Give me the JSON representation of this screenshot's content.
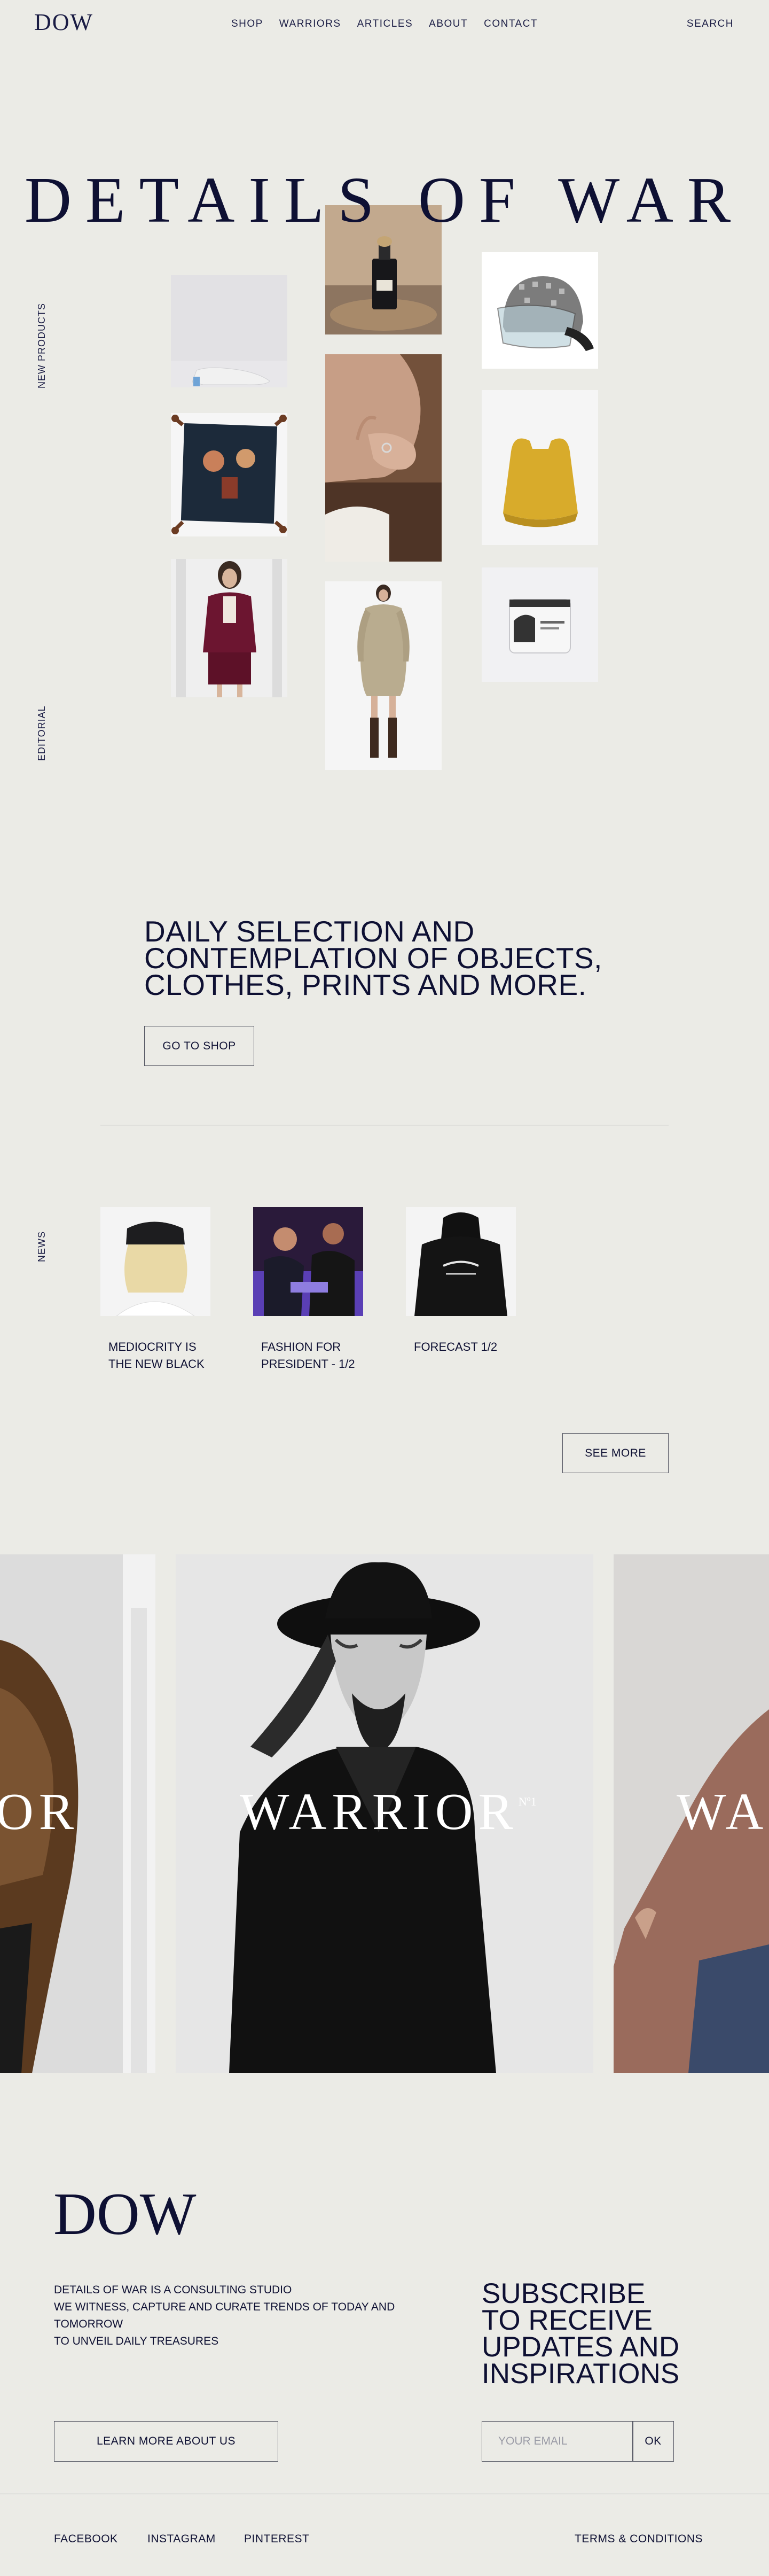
{
  "header": {
    "logo": "DOW",
    "nav": [
      "SHOP",
      "WARRIORS",
      "ARTICLES",
      "ABOUT",
      "CONTACT"
    ],
    "search": "SEARCH"
  },
  "hero": {
    "title": "DETAILS OF WAR",
    "side_label_products": "NEW PRODUCTS",
    "side_label_editorial": "EDITORIAL"
  },
  "tagline": {
    "line1": "DAILY SELECTION AND",
    "line2": "CONTEMPLATION OF OBJECTS,",
    "line3": "CLOTHES, PRINTS AND MORE.",
    "button": "GO TO SHOP"
  },
  "news": {
    "side_label": "NEWS",
    "items": [
      {
        "title": "MEDIOCRITY IS THE NEW BLACK"
      },
      {
        "title": "FASHION FOR PRESIDENT - 1/2"
      },
      {
        "title": "FORECAST 1/2"
      }
    ],
    "see_more": "SEE MORE"
  },
  "warriors": {
    "left_text": "OR",
    "center_text": "WARRIOR",
    "center_sup": "Nº1",
    "right_text": "WA"
  },
  "footer": {
    "logo": "DOW",
    "about_line1": "DETAILS OF WAR IS A CONSULTING STUDIO",
    "about_line2": "WE WITNESS, CAPTURE AND CURATE TRENDS OF TODAY AND",
    "about_line3": "TOMORROW",
    "about_line4": "TO UNVEIL DAILY TREASURES",
    "learn_more": "LEARN MORE ABOUT US",
    "subscribe_line1": "SUBSCRIBE",
    "subscribe_line2": "TO RECEIVE",
    "subscribe_line3": "UPDATES AND",
    "subscribe_line4": "INSPIRATIONS",
    "email_placeholder": "YOUR EMAIL",
    "ok": "OK",
    "links": [
      "FACEBOOK",
      "INSTAGRAM",
      "PINTEREST"
    ],
    "terms": "TERMS & CONDITIONS"
  },
  "colors": {
    "background": "#ebebe6",
    "ink": "#0e1033",
    "border": "#50525f"
  }
}
